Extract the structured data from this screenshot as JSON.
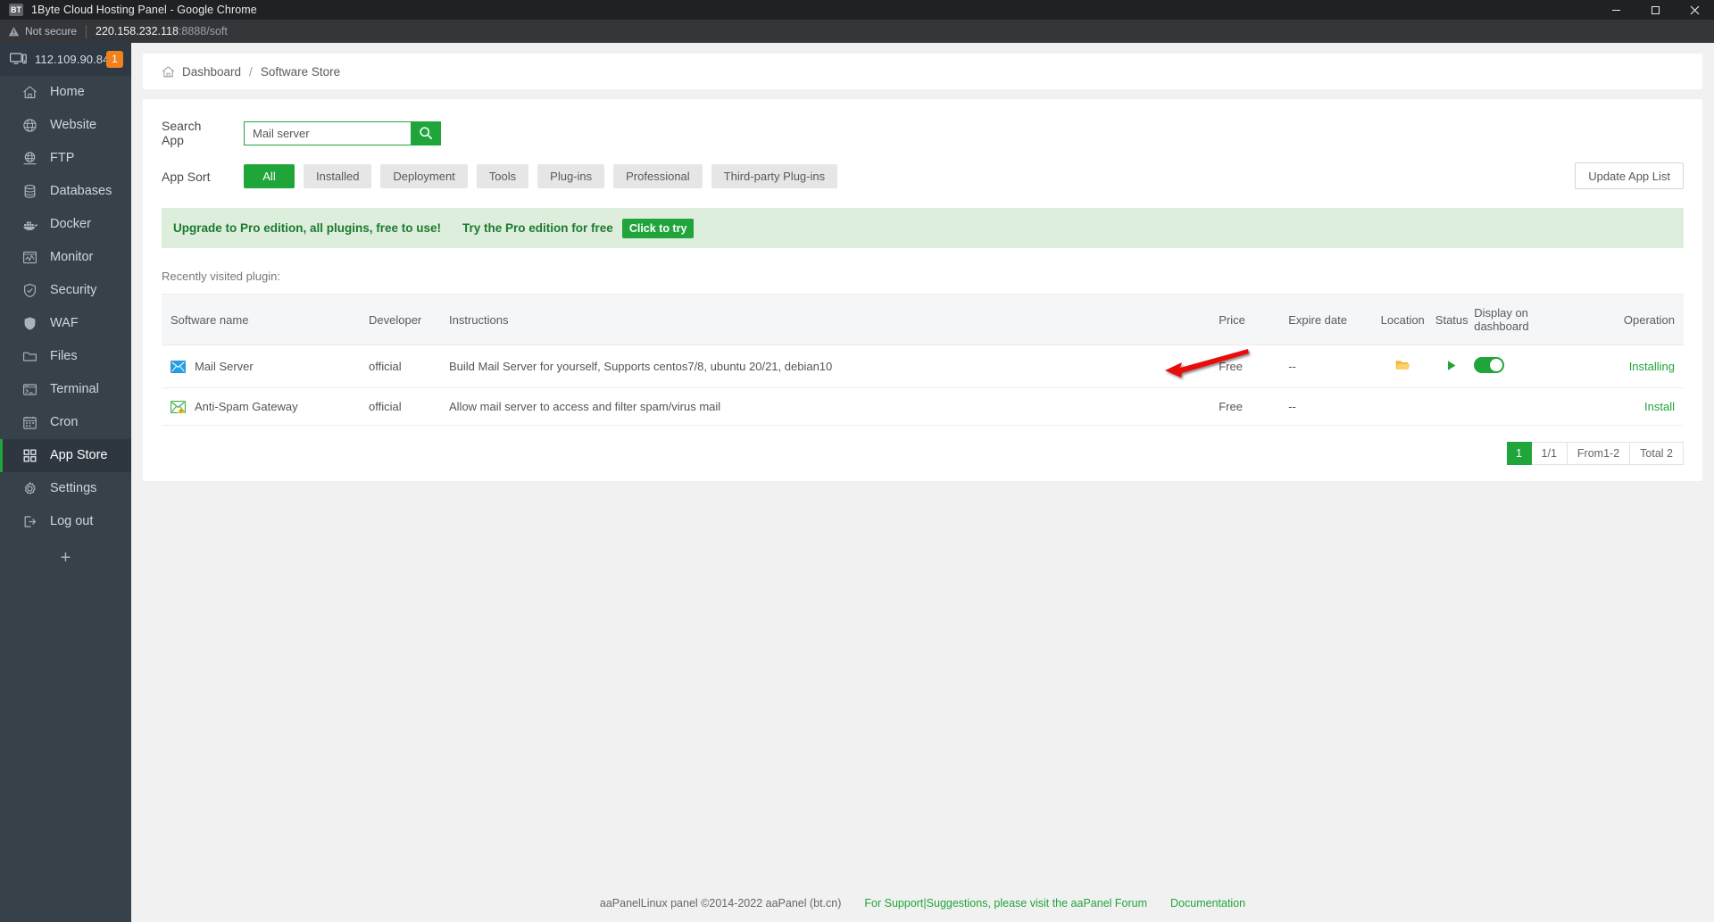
{
  "browser": {
    "favicon_text": "BT",
    "tab_title": "1Byte Cloud Hosting Panel - Google Chrome",
    "security_label": "Not secure",
    "url_host": "220.158.232.118",
    "url_rest": ":8888/soft",
    "minimize_icon": "minimize-icon",
    "maximize_icon": "maximize-icon",
    "close_icon": "close-icon"
  },
  "sidebar": {
    "ip": "112.109.90.84",
    "badge": "1",
    "add_label": "+",
    "items": [
      {
        "label": "Home",
        "icon": "home-icon",
        "active": false
      },
      {
        "label": "Website",
        "icon": "globe-icon",
        "active": false
      },
      {
        "label": "FTP",
        "icon": "ftp-icon",
        "active": false
      },
      {
        "label": "Databases",
        "icon": "database-icon",
        "active": false
      },
      {
        "label": "Docker",
        "icon": "docker-icon",
        "active": false
      },
      {
        "label": "Monitor",
        "icon": "monitor-chart-icon",
        "active": false
      },
      {
        "label": "Security",
        "icon": "shield-check-icon",
        "active": false
      },
      {
        "label": "WAF",
        "icon": "shield-icon",
        "active": false
      },
      {
        "label": "Files",
        "icon": "folder-icon",
        "active": false
      },
      {
        "label": "Terminal",
        "icon": "terminal-icon",
        "active": false
      },
      {
        "label": "Cron",
        "icon": "calendar-icon",
        "active": false
      },
      {
        "label": "App Store",
        "icon": "grid-icon",
        "active": true
      },
      {
        "label": "Settings",
        "icon": "gear-icon",
        "active": false
      },
      {
        "label": "Log out",
        "icon": "logout-icon",
        "active": false
      }
    ]
  },
  "breadcrumb": {
    "home_icon": "home-icon",
    "root": "Dashboard",
    "separator": "/",
    "current": "Software Store"
  },
  "search": {
    "label": "Search App",
    "value": "Mail server",
    "placeholder": "",
    "button_icon": "search-icon"
  },
  "app_sort": {
    "label": "App Sort",
    "chips": [
      {
        "label": "All",
        "active": true
      },
      {
        "label": "Installed",
        "active": false
      },
      {
        "label": "Deployment",
        "active": false
      },
      {
        "label": "Tools",
        "active": false
      },
      {
        "label": "Plug-ins",
        "active": false
      },
      {
        "label": "Professional",
        "active": false
      },
      {
        "label": "Third-party Plug-ins",
        "active": false
      }
    ],
    "update_button": "Update App List"
  },
  "promo": {
    "headline": "Upgrade to Pro edition, all plugins, free to use!",
    "subtext": "Try the Pro edition for free",
    "cta": "Click to try"
  },
  "table": {
    "caption": "Recently visited plugin:",
    "headers": {
      "name": "Software name",
      "developer": "Developer",
      "instructions": "Instructions",
      "price": "Price",
      "expire": "Expire date",
      "location": "Location",
      "status": "Status",
      "display": "Display on dashboard",
      "operation": "Operation"
    },
    "rows": [
      {
        "icon": "mail-envelope-icon",
        "name": "Mail Server",
        "developer": "official",
        "instructions": "Build Mail Server for yourself, Supports centos7/8, ubuntu 20/21, debian10",
        "price": "Free",
        "expire": "--",
        "location_icon": "folder-open-icon",
        "status_icon": "play-icon",
        "toggle_on": true,
        "operation": "Installing"
      },
      {
        "icon": "antispam-envelope-icon",
        "name": "Anti-Spam Gateway",
        "developer": "official",
        "instructions": "Allow mail server to access and filter spam/virus mail",
        "price": "Free",
        "expire": "--",
        "location_icon": "",
        "status_icon": "",
        "toggle_on": null,
        "operation": "Install"
      }
    ]
  },
  "pagination": {
    "current_page": "1",
    "pages": "1/1",
    "range": "From1-2",
    "total": "Total 2"
  },
  "footer": {
    "copyright": "aaPanelLinux panel ©2014-2022 aaPanel (bt.cn)",
    "support_link": "For Support|Suggestions, please visit the aaPanel Forum",
    "docs_link": "Documentation"
  },
  "annotation": {
    "arrow_color": "#e8100e",
    "name": "red-arrow-annotation"
  },
  "colors": {
    "accent_green": "#20a53a",
    "sidebar_bg": "#37414a",
    "badge_orange": "#f0821e"
  }
}
